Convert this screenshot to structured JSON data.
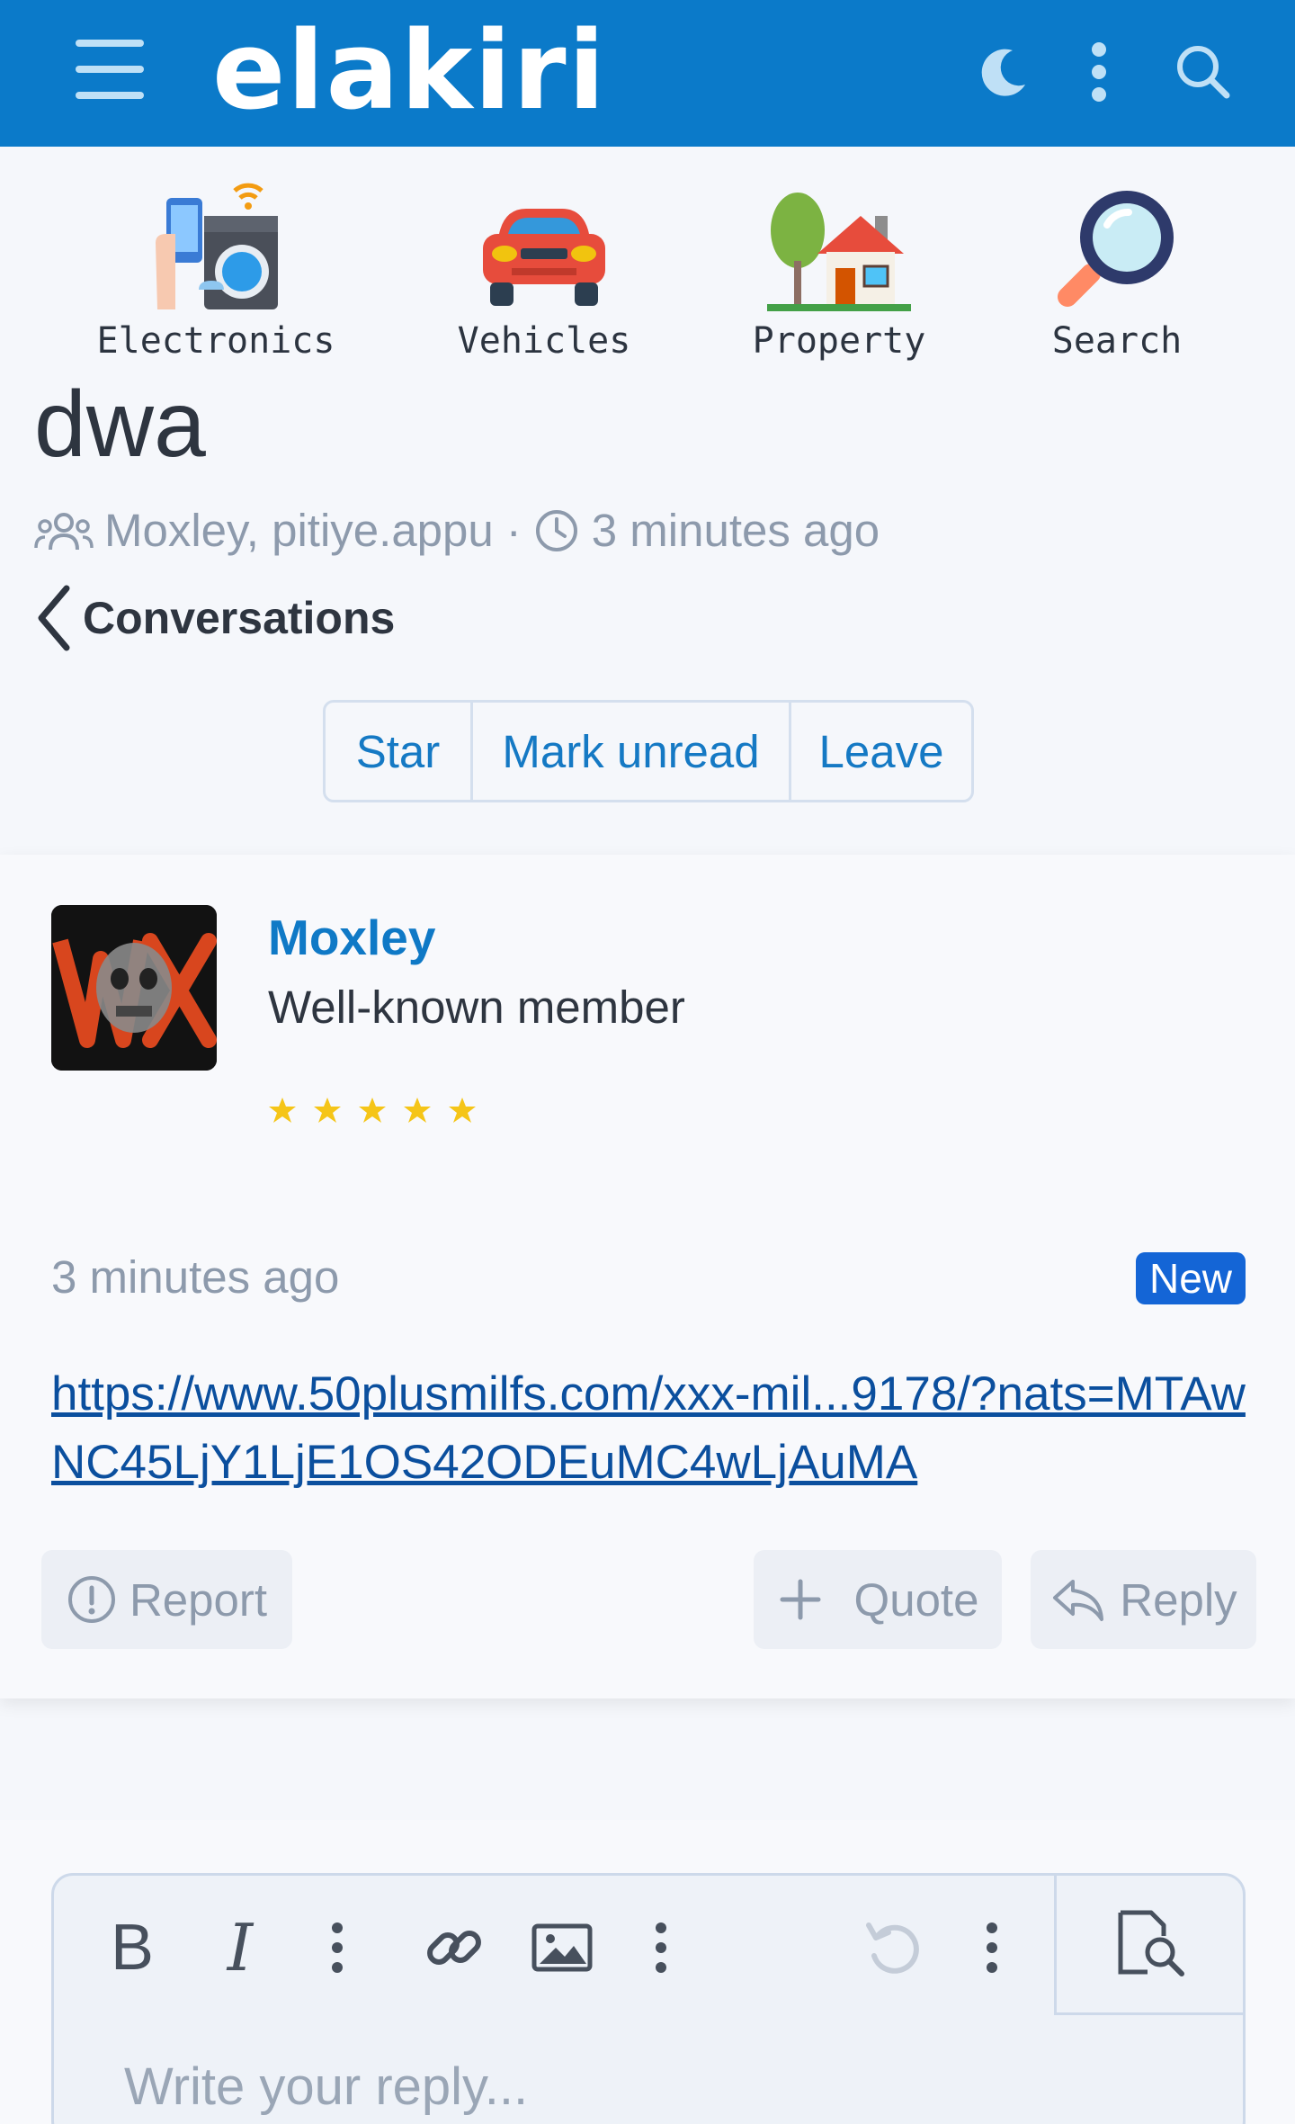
{
  "header": {
    "logo": "elakiri",
    "icons": [
      "menu-icon",
      "moon-icon",
      "more-vertical-icon",
      "search-icon"
    ],
    "color": "#0b7ac9"
  },
  "categories": [
    {
      "label": "Electronics",
      "icon": "electronics-icon"
    },
    {
      "label": "Vehicles",
      "icon": "car-icon"
    },
    {
      "label": "Property",
      "icon": "house-icon"
    },
    {
      "label": "Search",
      "icon": "magnifier-icon"
    }
  ],
  "conversation": {
    "title": "dwa",
    "participants": "Moxley, pitiye.appu",
    "separator": "·",
    "time": "3 minutes ago",
    "back_label": "Conversations",
    "buttons": {
      "star": "Star",
      "mark_unread": "Mark unread",
      "leave": "Leave"
    }
  },
  "message": {
    "author": "Moxley",
    "user_title": "Well-known member",
    "star_count": 5,
    "time": "3 minutes ago",
    "badge": "New",
    "link_text": "https://www.50plusmilfs.com/xxx-mil...9178/?nats=MTAwNC45LjY1LjE1OS42ODEuMC4wLjAuMA",
    "actions": {
      "report": "Report",
      "quote": "Quote",
      "reply": "Reply"
    }
  },
  "editor": {
    "toolbar": [
      "bold",
      "italic",
      "more",
      "link",
      "image",
      "more",
      "undo",
      "more",
      "preview"
    ],
    "bold_label": "B",
    "italic_label": "I",
    "placeholder": "Write your reply..."
  },
  "colors": {
    "accent": "#0f79c6",
    "badge": "#1465d6",
    "star": "#f5c518"
  }
}
